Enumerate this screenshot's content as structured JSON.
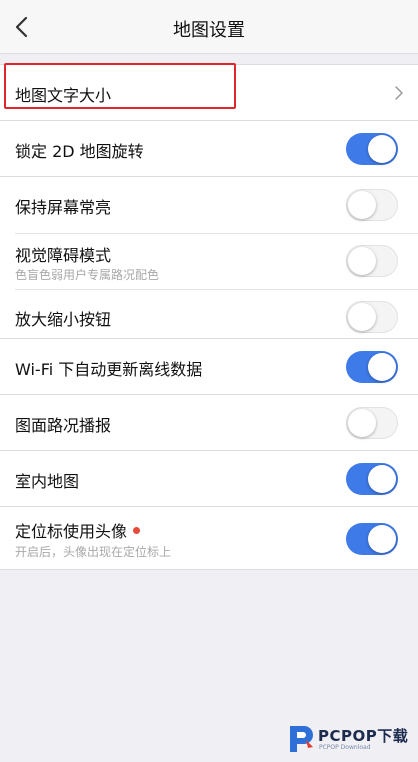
{
  "header": {
    "title": "地图设置",
    "back_icon": "chevron-left-icon"
  },
  "groups": [
    {
      "rows": [
        {
          "label": "地图文字大小",
          "control": "chevron"
        }
      ]
    },
    {
      "rows": [
        {
          "label": "锁定 2D 地图旋转",
          "control": "toggle",
          "on": true
        }
      ]
    },
    {
      "rows": [
        {
          "label": "保持屏幕常亮",
          "control": "toggle",
          "on": false
        },
        {
          "label": "视觉障碍模式",
          "sub": "色盲色弱用户专属路况配色",
          "control": "toggle",
          "on": false
        },
        {
          "label": "放大缩小按钮",
          "control": "toggle",
          "on": false
        }
      ]
    },
    {
      "rows": [
        {
          "label": "Wi-Fi 下自动更新离线数据",
          "control": "toggle",
          "on": true
        }
      ]
    },
    {
      "rows": [
        {
          "label": "图面路况播报",
          "control": "toggle",
          "on": false
        }
      ]
    },
    {
      "rows": [
        {
          "label": "室内地图",
          "control": "toggle",
          "on": true
        }
      ]
    },
    {
      "rows": [
        {
          "label": "定位标使用头像",
          "sub": "开启后，头像出现在定位标上",
          "control": "toggle",
          "on": true,
          "badge": "red-dot"
        }
      ]
    }
  ],
  "colors": {
    "toggle_on": "#3e7ae8",
    "highlight": "#e0262b",
    "background": "#efeff4"
  },
  "watermark": {
    "name": "PCPOP下载",
    "sub": "PCPOP Download"
  }
}
